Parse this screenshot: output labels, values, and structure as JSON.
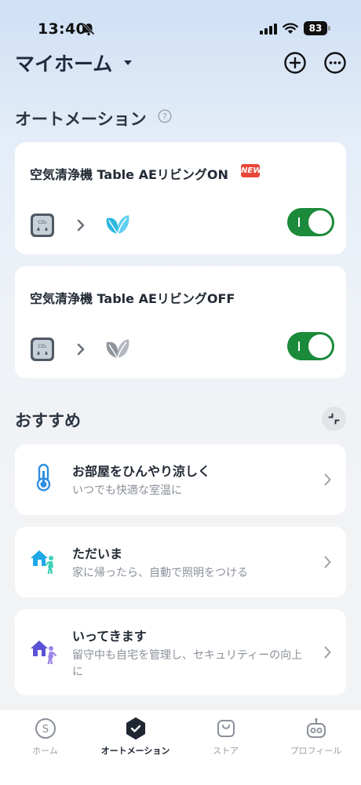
{
  "status_bar": {
    "time": "13:40",
    "battery": "83"
  },
  "header": {
    "title": "マイホーム"
  },
  "automation": {
    "section_title": "オートメーション",
    "items": [
      {
        "title": "空気清浄機 Table AEリビングON",
        "badge": "NEW",
        "enabled": true,
        "action_color": "#2eb8e0"
      },
      {
        "title": "空気清浄機 Table AEリビングOFF",
        "enabled": true,
        "action_color": "#9aa0a6"
      }
    ]
  },
  "recommend": {
    "section_title": "おすすめ",
    "items": [
      {
        "title": "お部屋をひんやり涼しく",
        "desc": "いつでも快適な室温に",
        "icon": "thermometer-icon"
      },
      {
        "title": "ただいま",
        "desc": "家に帰ったら、自動で照明をつける",
        "icon": "home-arrive-icon"
      },
      {
        "title": "いってきます",
        "desc": "留守中も自宅を管理し、セキュリティーの向上に",
        "icon": "home-leave-icon"
      }
    ]
  },
  "bottom_nav": {
    "items": [
      {
        "label": "ホーム",
        "icon": "home-coin-icon",
        "active": false
      },
      {
        "label": "オートメーション",
        "icon": "automation-icon",
        "active": true
      },
      {
        "label": "ストア",
        "icon": "store-bag-icon",
        "active": false
      },
      {
        "label": "プロフィール",
        "icon": "profile-robot-icon",
        "active": false
      }
    ]
  },
  "colors": {
    "toggle_on": "#1b8a3a",
    "new_badge": "#e8473a",
    "accent_blue": "#2f8fe0"
  }
}
